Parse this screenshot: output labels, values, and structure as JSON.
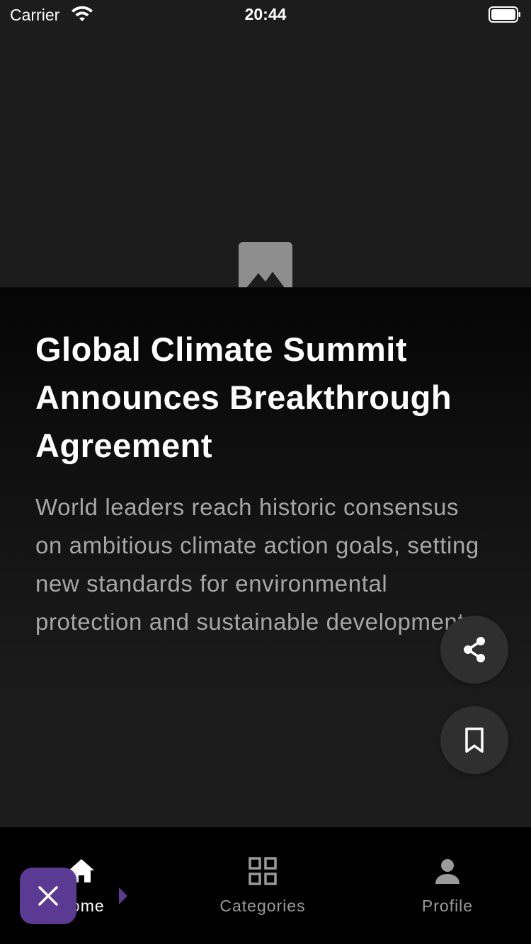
{
  "status_bar": {
    "carrier": "Carrier",
    "time": "20:44"
  },
  "article": {
    "headline": "Global Climate Summit Announces Breakthrough Agreement",
    "summary": "World leaders reach historic consensus on ambitious climate action goals, setting new standards for environmental protection and sustainable development."
  },
  "actions": {
    "share_icon": "share-icon",
    "bookmark_icon": "bookmark-icon"
  },
  "nav": {
    "items": [
      {
        "label": "Home",
        "icon": "home-icon",
        "active": true
      },
      {
        "label": "Categories",
        "icon": "grid-icon",
        "active": false
      },
      {
        "label": "Profile",
        "icon": "person-icon",
        "active": false
      }
    ]
  },
  "close_fab": {
    "icon": "close-icon"
  },
  "colors": {
    "background": "#1c1c1c",
    "nav_background": "#000000",
    "accent": "#5b3a93",
    "summary_text": "#a6a6a6",
    "fab_background": "#2f2f2f"
  }
}
